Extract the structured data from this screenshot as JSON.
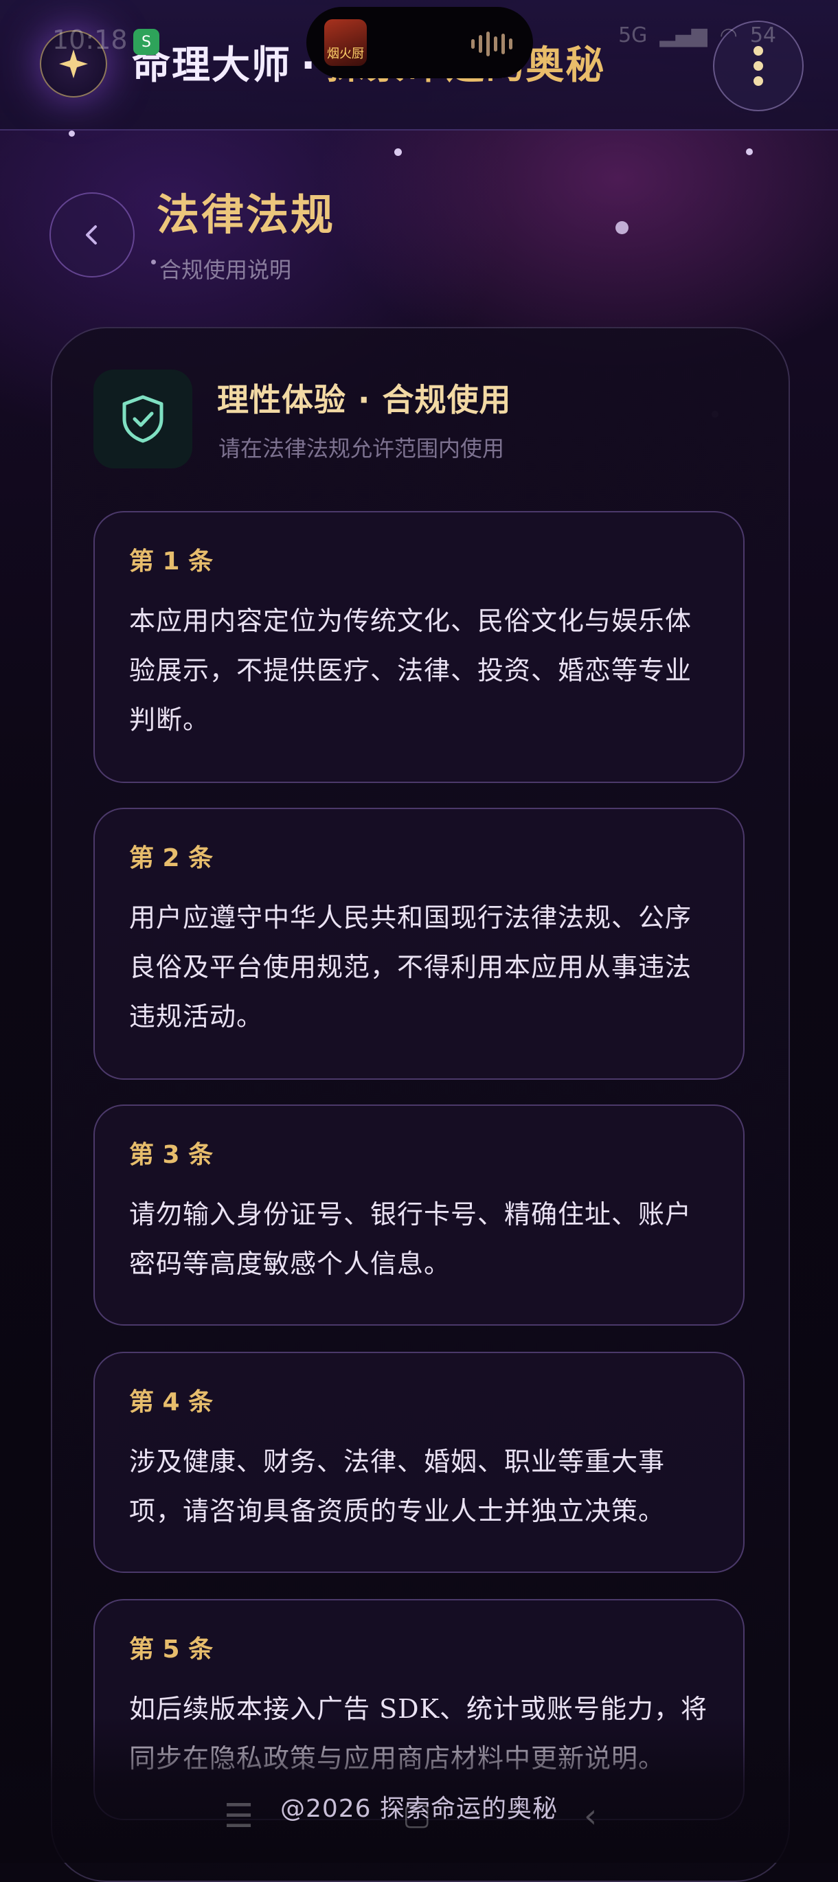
{
  "status_bar": {
    "time": "10:18",
    "notification_app": "S",
    "island_thumb_label": "烟火厨",
    "network": "5G",
    "battery": "54"
  },
  "header": {
    "app_name": "命理大师",
    "separator": "·",
    "tagline": "探索命运的奥秘"
  },
  "page": {
    "title": "法律法规",
    "subtitle": "合规使用说明"
  },
  "card": {
    "title": "理性体验 · 合规使用",
    "subtitle": "请在法律法规允许范围内使用",
    "articles": [
      {
        "label": "第 1 条",
        "text": "本应用内容定位为传统文化、民俗文化与娱乐体验展示，不提供医疗、法律、投资、婚恋等专业判断。"
      },
      {
        "label": "第 2 条",
        "text": "用户应遵守中华人民共和国现行法律法规、公序良俗及平台使用规范，不得利用本应用从事违法违规活动。"
      },
      {
        "label": "第 3 条",
        "text": "请勿输入身份证号、银行卡号、精确住址、账户密码等高度敏感个人信息。"
      },
      {
        "label": "第 4 条",
        "text": "涉及健康、财务、法律、婚姻、职业等重大事项，请咨询具备资质的专业人士并独立决策。"
      },
      {
        "label": "第 5 条",
        "text": "如后续版本接入广告 SDK、统计或账号能力，将同步在隐私政策与应用商店材料中更新说明。"
      }
    ]
  },
  "footer": {
    "copyright": "@2026 探索命运的奥秘"
  },
  "icons": {
    "logo": "sparkle-icon",
    "more": "more-vertical-icon",
    "back": "chevron-left-icon",
    "shield": "shield-check-icon"
  },
  "colors": {
    "gold": "#e7bd6c",
    "purple_bg": "#1a0e2f",
    "teal": "#7fe0c2"
  }
}
